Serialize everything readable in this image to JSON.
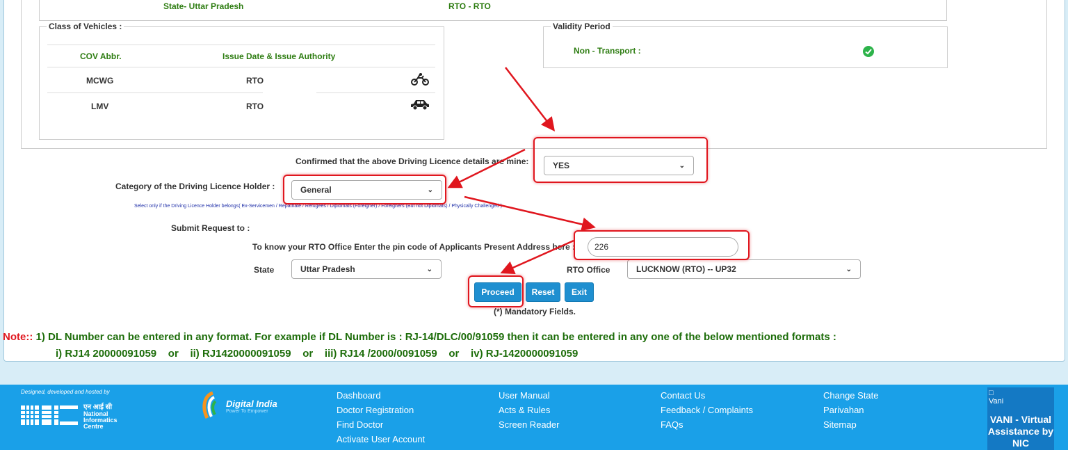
{
  "top": {
    "state_label": "State- Uttar Pradesh",
    "rto_label": "RTO - RTO"
  },
  "cov": {
    "legend": "Class of Vehicles :",
    "headers": [
      "COV Abbr.",
      "Issue Date & Issue Authority"
    ],
    "rows": [
      {
        "abbr": "MCWG",
        "authority": "RTO",
        "icon": "motorcycle-icon"
      },
      {
        "abbr": "LMV",
        "authority": "RTO",
        "icon": "car-icon"
      }
    ]
  },
  "validity": {
    "legend": "Validity Period",
    "non_transport_label": "Non - Transport :",
    "status_icon": "check-circle-icon"
  },
  "form": {
    "confirm_label": "Confirmed that the above Driving Licence details are mine:",
    "confirm_value": "YES",
    "category_label": "Category of the Driving Licence Holder :",
    "category_value": "General",
    "category_hint": "Select only if the Driving Licence Holder belongs( Ex-Servicemen / Repatriate / Refugees / Diplomats (Foreigner) / Foreigners (But not Diplomats) / Physically Challenged )",
    "submit_label": "Submit Request to :",
    "pincode_label": "To know your RTO Office Enter the pin code of Applicants Present Address here :",
    "pincode_value": "226",
    "state_label": "State",
    "state_value": "Uttar Pradesh",
    "rto_label": "RTO Office",
    "rto_value": "LUCKNOW (RTO) -- UP32",
    "proceed": "Proceed",
    "reset": "Reset",
    "exit": "Exit",
    "mandatory": "(*) Mandatory Fields."
  },
  "note": {
    "prefix": "Note::",
    "line1": " 1) DL Number can be entered in any format. For example if DL Number is : RJ-14/DLC/00/91059 then it can be entered in any one of the below mentioned formats :",
    "line2": "i) RJ14 20000091059    or    ii) RJ1420000091059    or    iii) RJ14 /2000/0091059    or    iv) RJ-1420000091059"
  },
  "footer": {
    "designed": "Designed, developed and hosted by",
    "nic_hindi": "एन आई सी",
    "nic_name": [
      "National",
      "Informatics",
      "Centre"
    ],
    "digital_india": "Digital India",
    "digital_india_tagline": "Power To Empower",
    "col1": [
      "Dashboard",
      "Doctor Registration",
      "Find Doctor",
      "Activate User Account"
    ],
    "col2": [
      "User Manual",
      "Acts & Rules",
      "Screen Reader"
    ],
    "col3": [
      "Contact Us",
      "Feedback / Complaints",
      "FAQs"
    ],
    "col4": [
      "Change State",
      "Parivahan",
      "Sitemap"
    ],
    "vani_alt": "Vani",
    "vani_text": "VANI - Virtual Assistance by NIC"
  },
  "colors": {
    "accent": "#1aa0e8",
    "highlight": "#e0161e",
    "green": "#2e7d12"
  }
}
